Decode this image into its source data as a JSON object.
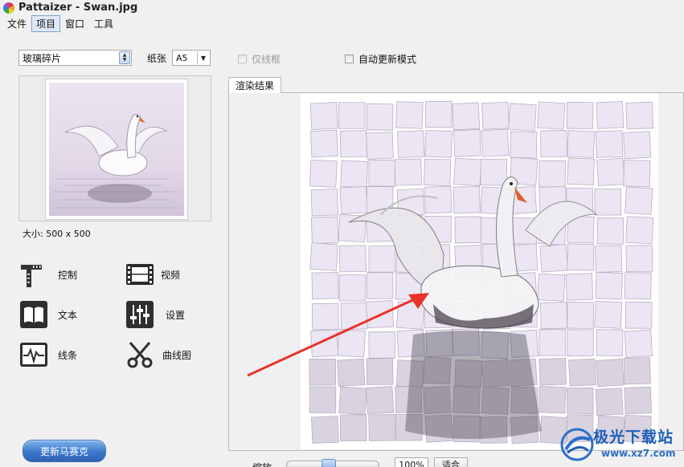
{
  "window": {
    "title": "Pattaizer - Swan.jpg"
  },
  "menu": {
    "items": [
      "文件",
      "项目",
      "窗口",
      "工具"
    ],
    "active_index": 1
  },
  "toolbar": {
    "filter_value": "玻璃碎片",
    "paper_label": "纸张",
    "paper_value": "A5",
    "wireframe_label": "仅线框",
    "autoupdate_label": "自动更新模式"
  },
  "preview": {
    "size_label": "大小: 500 x 500"
  },
  "tools": {
    "control": "控制",
    "video": "视频",
    "text": "文本",
    "settings": "设置",
    "lines": "线条",
    "curves": "曲线图"
  },
  "update_button": "更新马赛克",
  "render": {
    "tab_label": "渲染结果"
  },
  "bottom": {
    "zoom_label": "缩放",
    "zoom_value": "100%",
    "fit_label": "适合"
  },
  "watermark": {
    "top": "极光下载站",
    "bottom": "www.xz7.com"
  },
  "colors": {
    "arrow": "#e8322a",
    "accent": "#3c78cc",
    "tile": "#ece6f4"
  },
  "icons": {
    "control": "ruler-icon",
    "video": "film-icon",
    "text": "book-icon",
    "settings": "sliders-icon",
    "lines": "pulse-icon",
    "curves": "scissors-icon"
  }
}
